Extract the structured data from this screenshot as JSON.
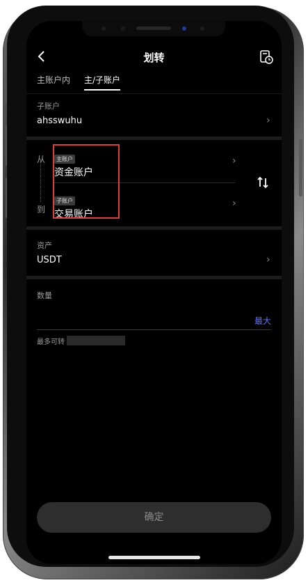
{
  "header": {
    "title": "划转"
  },
  "tabs": [
    {
      "label": "主账户内"
    },
    {
      "label": "主/子账户"
    }
  ],
  "subaccount": {
    "label": "子账户",
    "value": "ahsswuhu"
  },
  "transfer": {
    "from_label": "从",
    "to_label": "到",
    "from_tag": "主账户",
    "from_account": "资金账户",
    "to_tag": "子账户",
    "to_account": "交易账户"
  },
  "asset": {
    "label": "资产",
    "value": "USDT"
  },
  "amount": {
    "label": "数量",
    "max_label": "最大",
    "available_label": "最多可转"
  },
  "confirm_label": "确定",
  "colors": {
    "accent": "#5b72ff",
    "highlight": "#e03a3a",
    "background": "#000000"
  }
}
